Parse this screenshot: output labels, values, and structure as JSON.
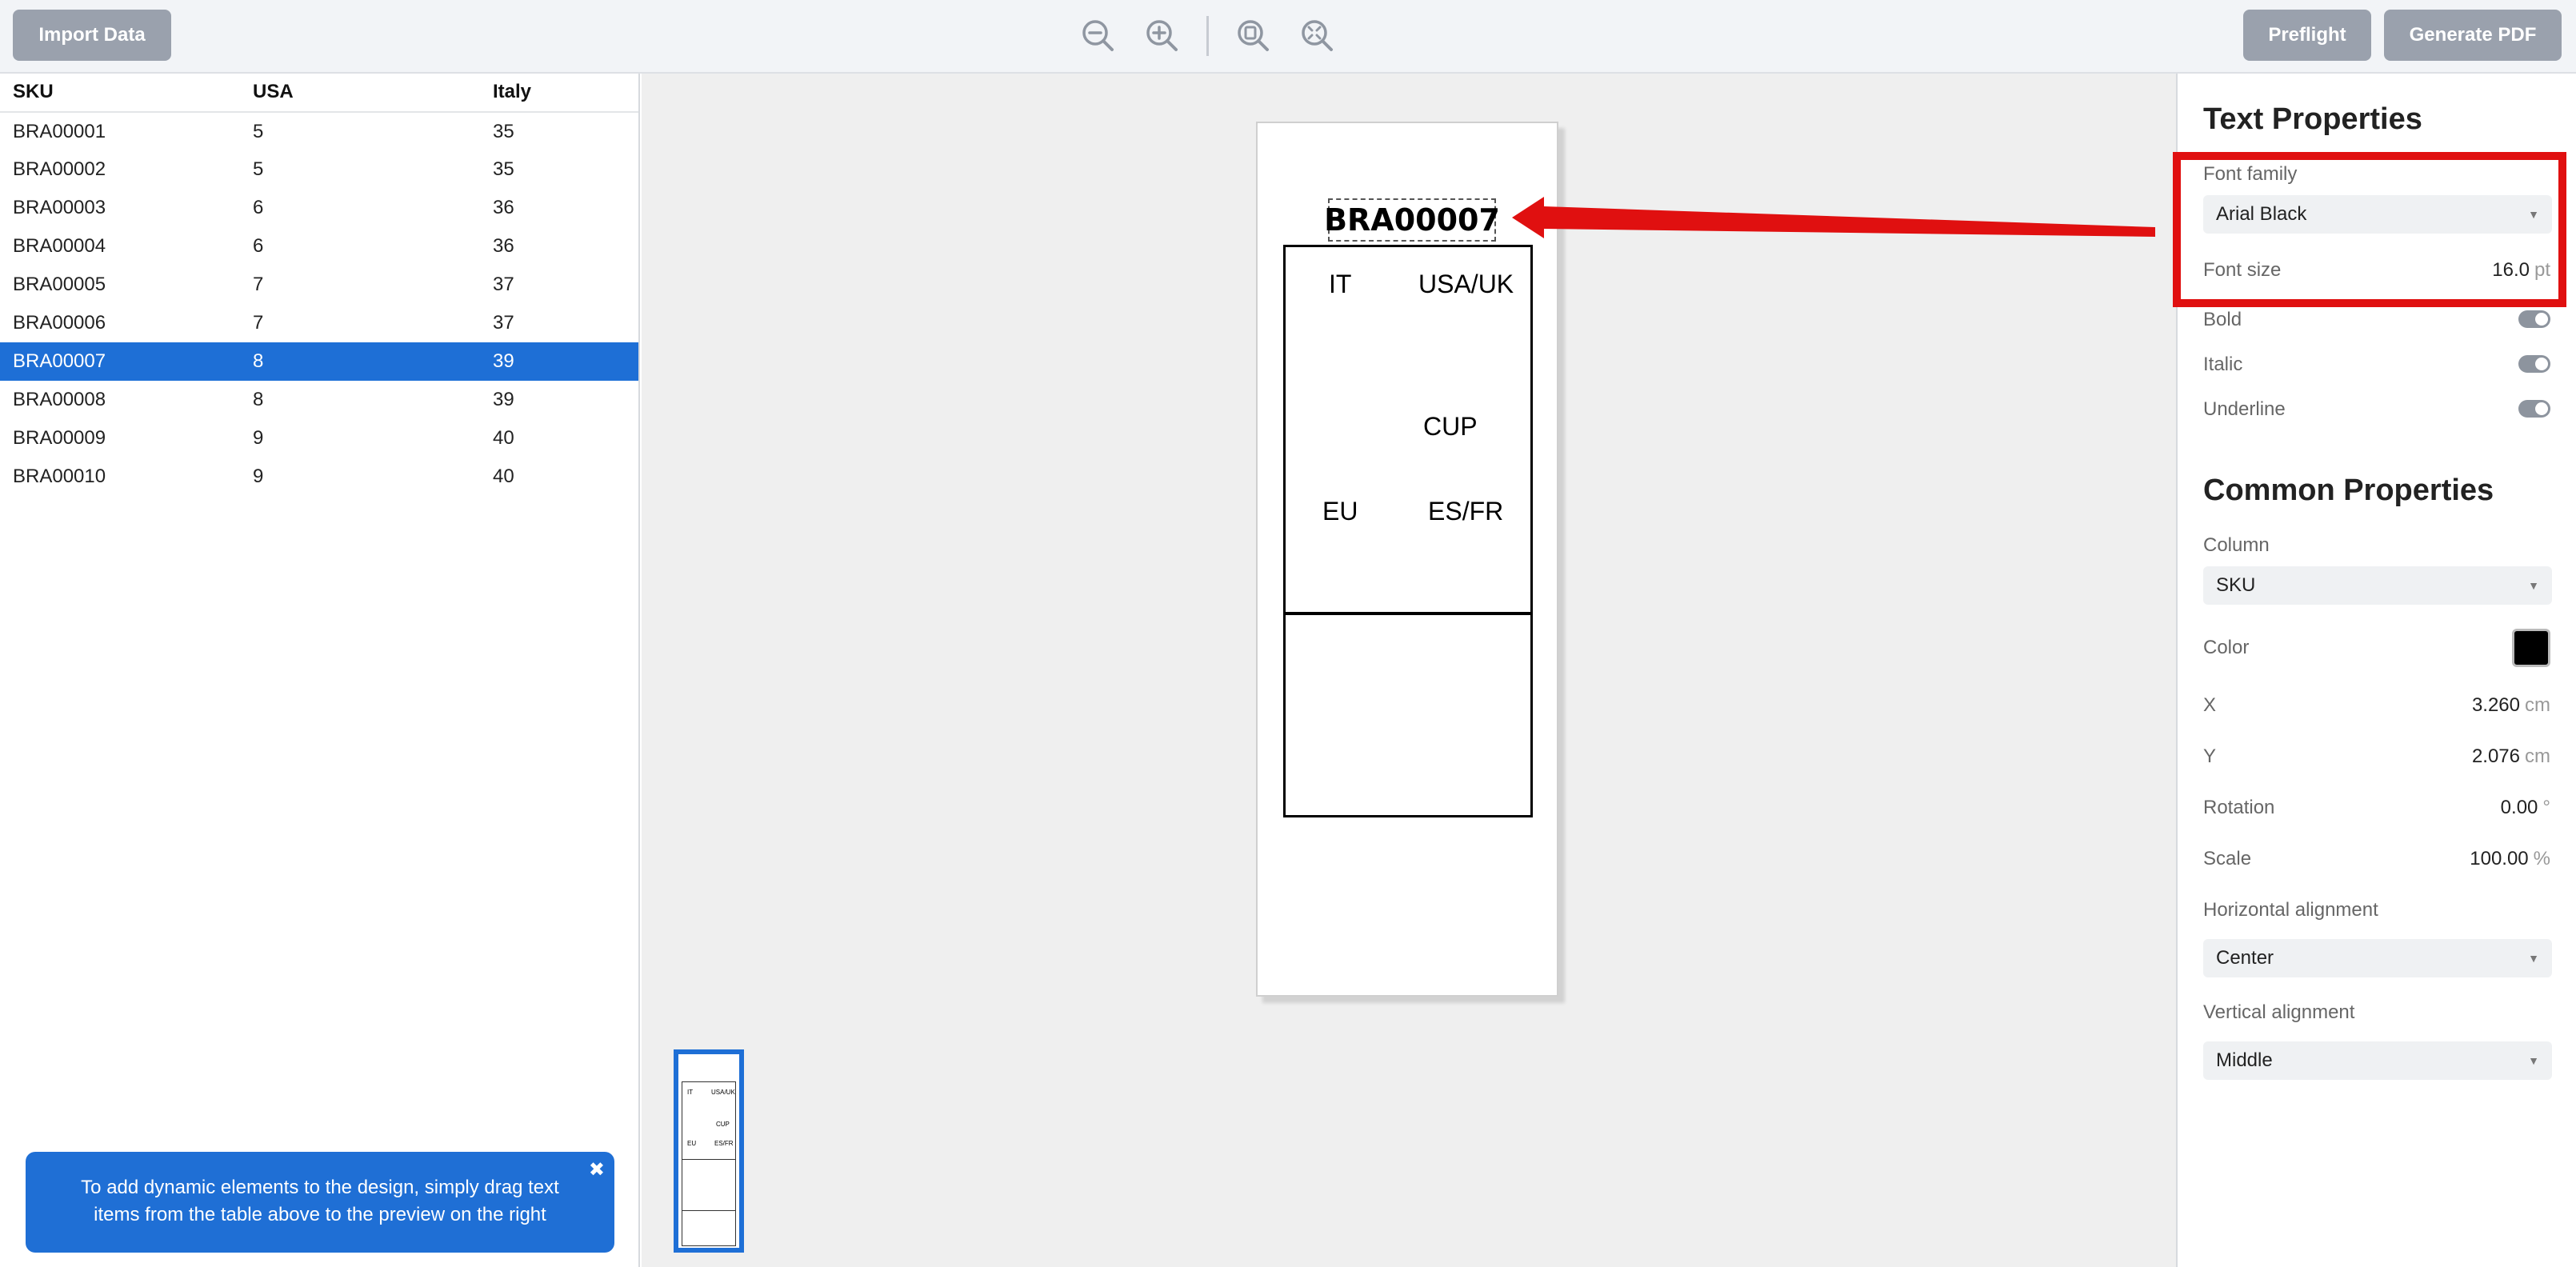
{
  "toolbar": {
    "import_label": "Import Data",
    "preflight_label": "Preflight",
    "generate_pdf_label": "Generate PDF",
    "icons": [
      "zoom-out-icon",
      "zoom-in-icon",
      "zoom-fit-icon",
      "zoom-reset-icon"
    ]
  },
  "table": {
    "columns": [
      "SKU",
      "USA",
      "Italy"
    ],
    "rows": [
      [
        "BRA00001",
        "5",
        "35"
      ],
      [
        "BRA00002",
        "5",
        "35"
      ],
      [
        "BRA00003",
        "6",
        "36"
      ],
      [
        "BRA00004",
        "6",
        "36"
      ],
      [
        "BRA00005",
        "7",
        "37"
      ],
      [
        "BRA00006",
        "7",
        "37"
      ],
      [
        "BRA00007",
        "8",
        "39"
      ],
      [
        "BRA00008",
        "8",
        "39"
      ],
      [
        "BRA00009",
        "9",
        "40"
      ],
      [
        "BRA00010",
        "9",
        "40"
      ]
    ],
    "selected_index": 6
  },
  "tip": {
    "text": "To add dynamic elements to the design, simply drag text items from the table above to the preview on the right",
    "close_glyph": "✖"
  },
  "preview": {
    "sku": "BRA00007",
    "labels": {
      "it": "IT",
      "usa_uk": "USA/UK",
      "cup": "CUP",
      "eu": "EU",
      "es_fr": "ES/FR"
    }
  },
  "text_properties": {
    "title": "Text Properties",
    "font_family_label": "Font family",
    "font_family_value": "Arial Black",
    "font_size_label": "Font size",
    "font_size_value": "16.0",
    "font_size_unit": "pt",
    "bold_label": "Bold",
    "italic_label": "Italic",
    "underline_label": "Underline"
  },
  "common_properties": {
    "title": "Common Properties",
    "column_label": "Column",
    "column_value": "SKU",
    "color_label": "Color",
    "color_value": "#000000",
    "x_label": "X",
    "x_value": "3.260",
    "x_unit": "cm",
    "y_label": "Y",
    "y_value": "2.076",
    "y_unit": "cm",
    "rotation_label": "Rotation",
    "rotation_value": "0.00",
    "rotation_unit": "°",
    "scale_label": "Scale",
    "scale_value": "100.00",
    "scale_unit": "%",
    "h_align_label": "Horizontal alignment",
    "h_align_value": "Center",
    "v_align_label": "Vertical alignment",
    "v_align_value": "Middle"
  },
  "colors": {
    "accent": "#1e6fd6",
    "button_gray": "#9aa1ad",
    "highlight_red": "#e01010"
  }
}
